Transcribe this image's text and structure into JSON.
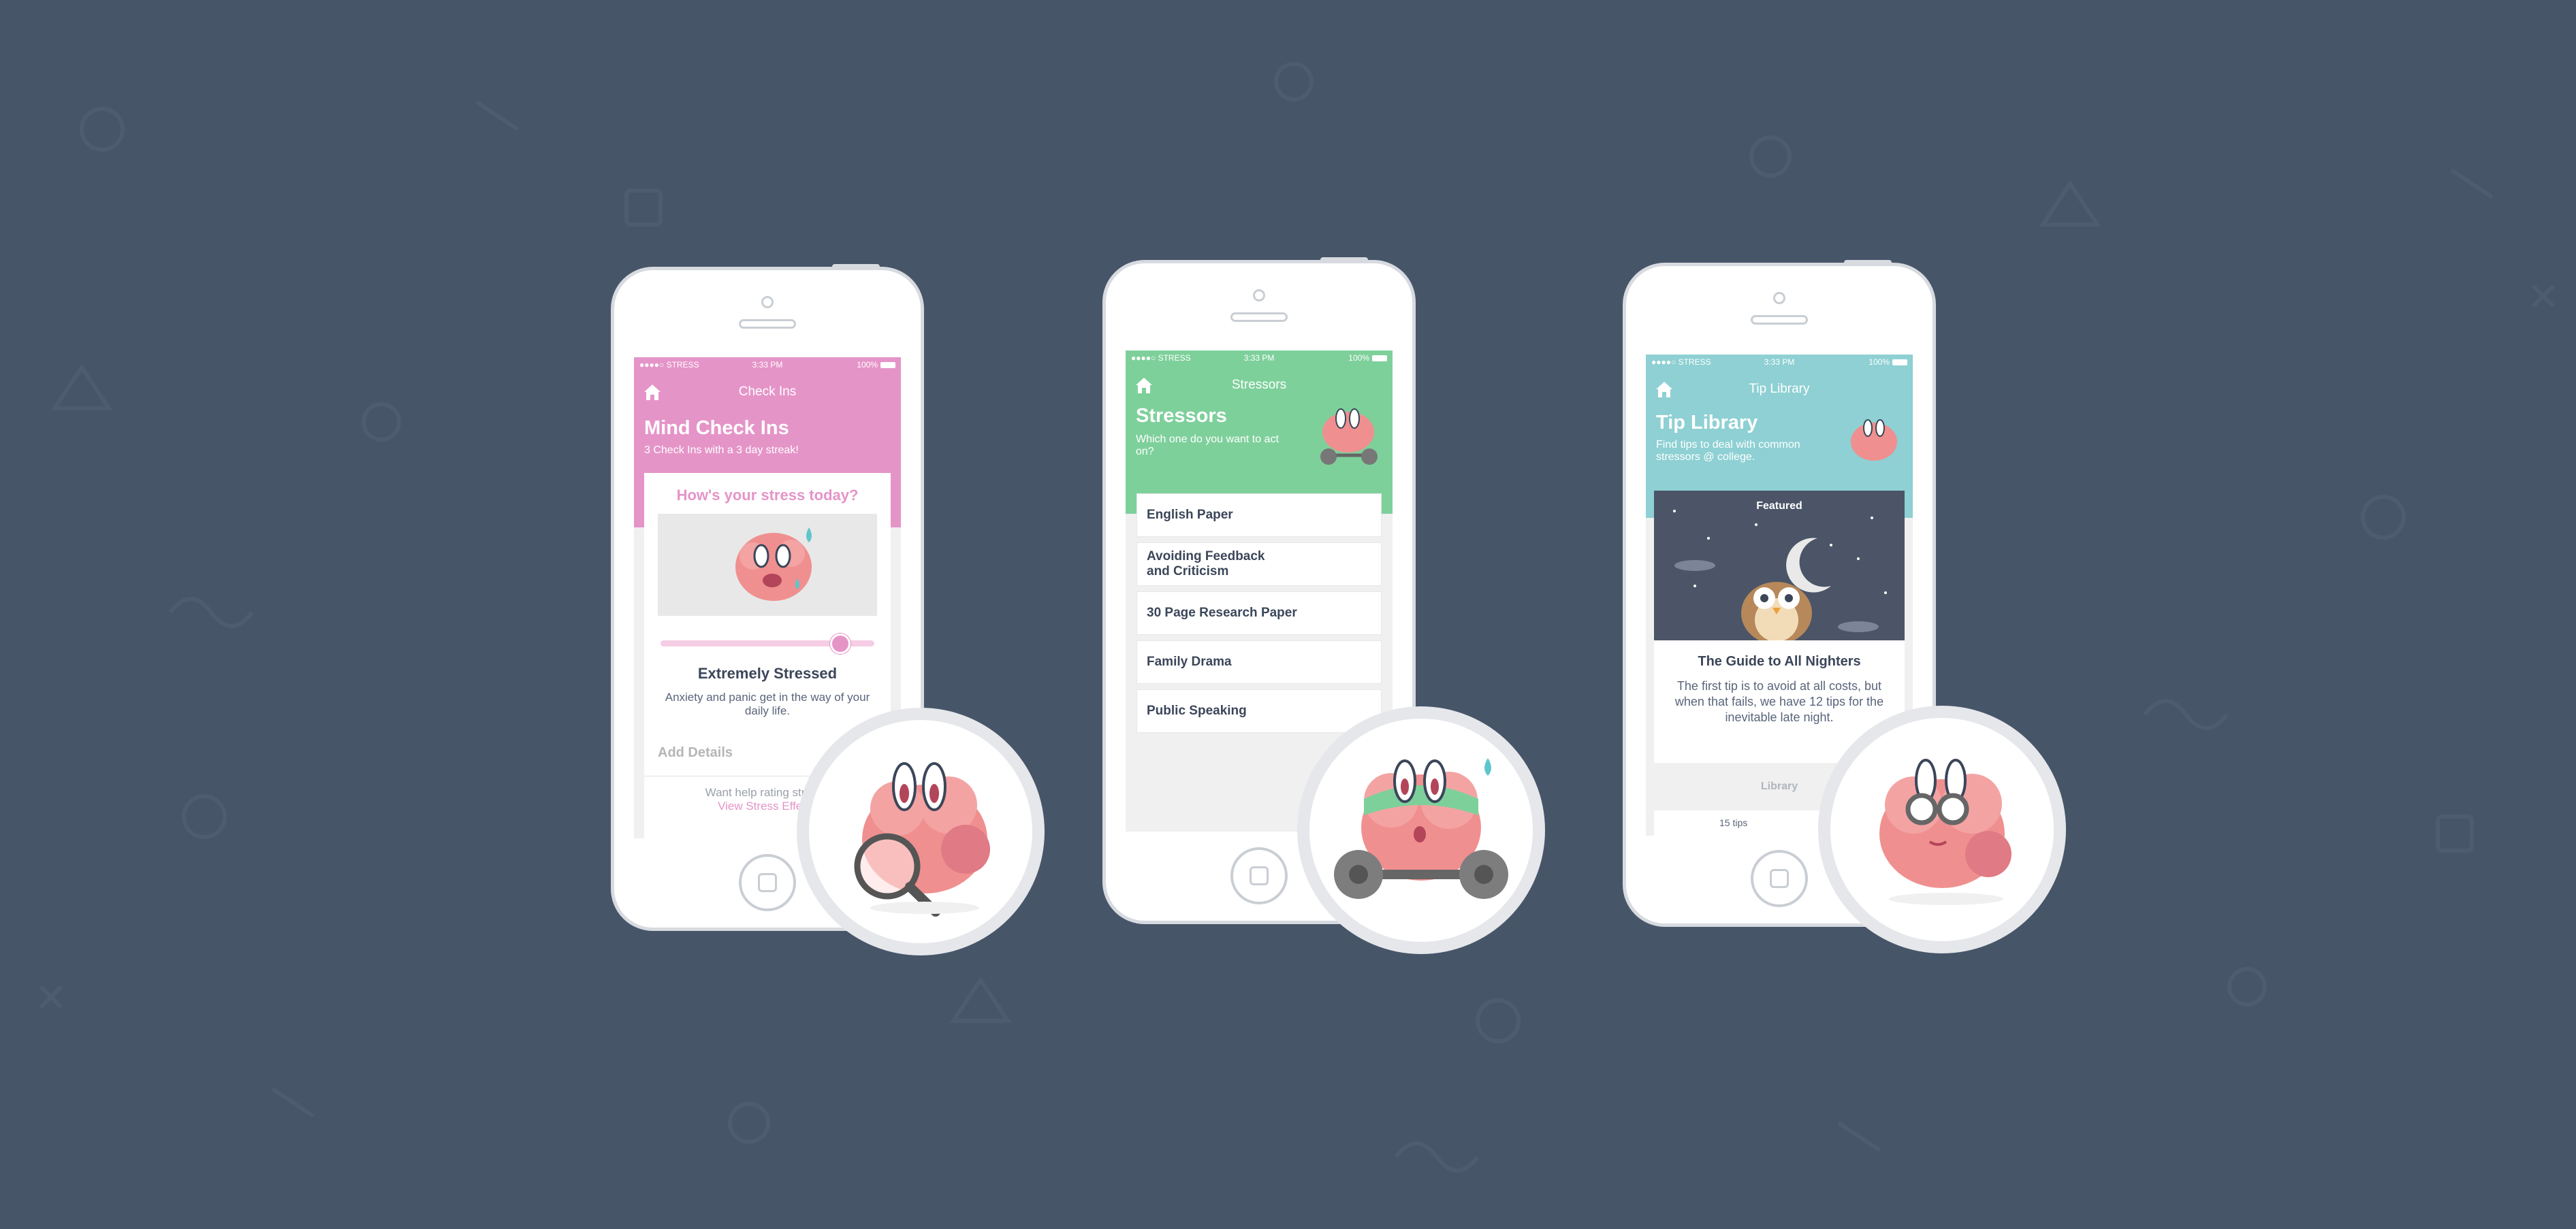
{
  "phone1": {
    "status": {
      "carrier": "●●●●○ STRESS",
      "time": "3:33 PM",
      "battery": "100%"
    },
    "nav_title": "Check Ins",
    "title": "Mind Check Ins",
    "subtitle": "3 Check Ins with a 3 day streak!",
    "question": "How's your stress today?",
    "stress_level_fraction": 0.84,
    "level_label": "Extremely Stressed",
    "level_desc": "Anxiety and panic get in the way of your daily life.",
    "add_details": "Add Details",
    "help_text": "Want help rating stress?",
    "help_link": "View Stress Effects",
    "accent": "#e594c8"
  },
  "phone2": {
    "status": {
      "carrier": "●●●●○ STRESS",
      "time": "3:33 PM",
      "battery": "100%"
    },
    "nav_title": "Stressors",
    "title": "Stressors",
    "subtitle": "Which one do you want to act on?",
    "items": [
      {
        "label": "English Paper"
      },
      {
        "label": "Avoiding Feedback and Criticism"
      },
      {
        "label": "30 Page Research Paper"
      },
      {
        "label": "Family Drama"
      },
      {
        "label": "Public Speaking"
      }
    ],
    "accent": "#7ed09b"
  },
  "phone3": {
    "status": {
      "carrier": "●●●●○ STRESS",
      "time": "3:33 PM",
      "battery": "100%"
    },
    "nav_title": "Tip Library",
    "title": "Tip Library",
    "subtitle": "Find tips to deal with common stressors @ college.",
    "featured_label": "Featured",
    "card_title": "The Guide to All Nighters",
    "card_body": "The first tip is to avoid at all costs, but when that fails, we have 12 tips for the inevitable late night.",
    "library_label": "Library",
    "tips_count": "15 tips",
    "accent": "#8ed0d3"
  },
  "icons": [
    "home-icon",
    "brain-magnifier-icon",
    "brain-weights-icon",
    "brain-glasses-icon",
    "owl-moon-illustration"
  ]
}
